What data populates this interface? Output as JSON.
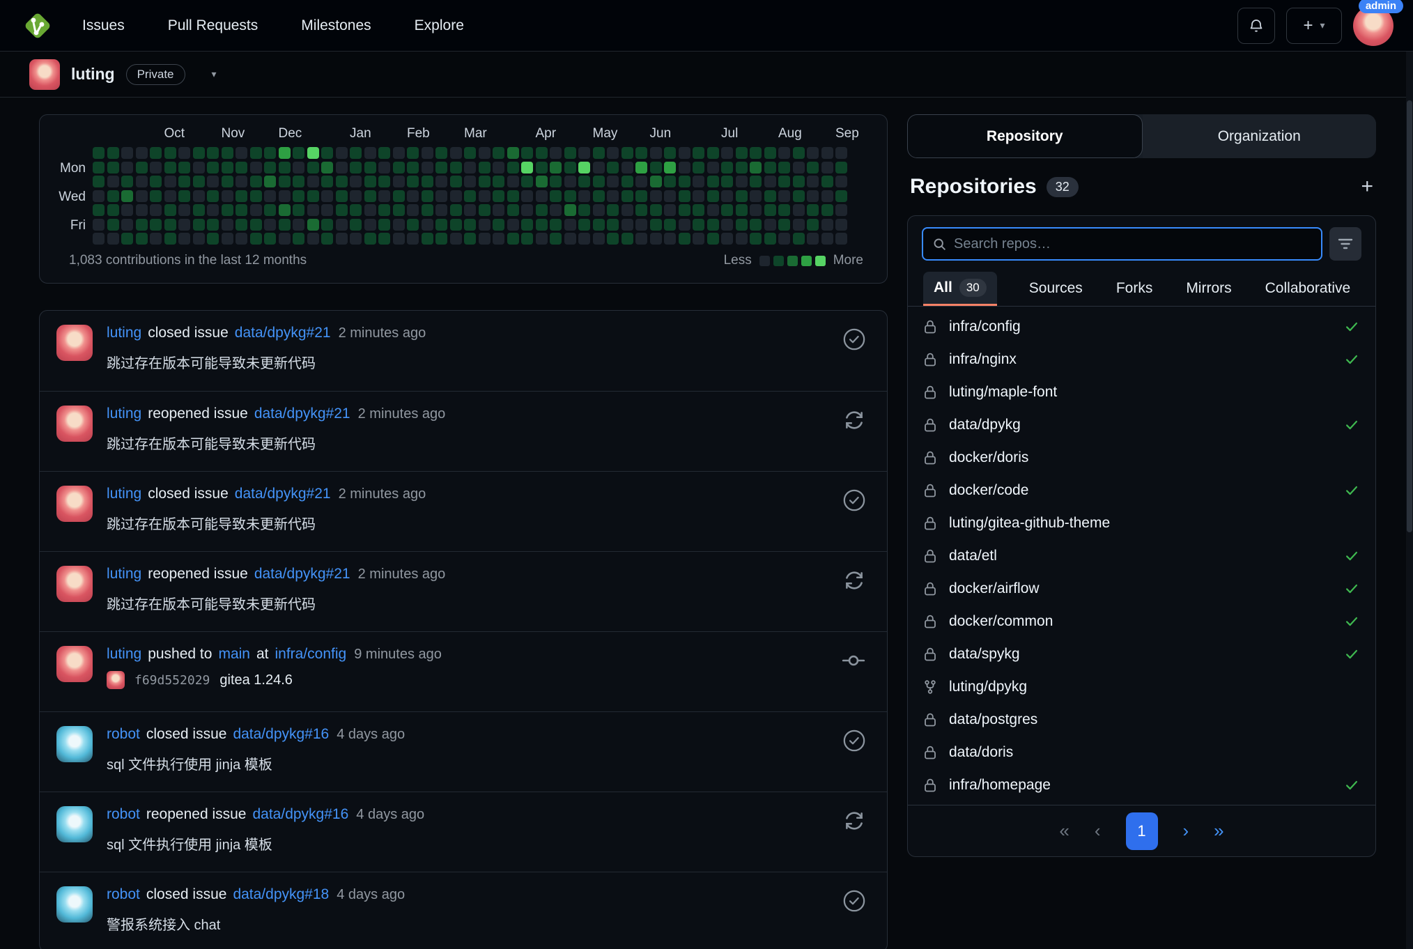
{
  "navbar": {
    "links": [
      "Issues",
      "Pull Requests",
      "Milestones",
      "Explore"
    ],
    "admin_badge": "admin",
    "plus_label": "+",
    "caret": "▾"
  },
  "subheader": {
    "username": "luting",
    "badge": "Private",
    "caret": "▾"
  },
  "heatmap": {
    "total_label": "1,083 contributions in the last 12 months",
    "less_label": "Less",
    "more_label": "More",
    "level_colors": [
      "#1e252e",
      "#0e4429",
      "#1a6b33",
      "#2ea043",
      "#56d364"
    ],
    "months": [
      {
        "label": "Oct",
        "col": 5
      },
      {
        "label": "Nov",
        "col": 9
      },
      {
        "label": "Dec",
        "col": 13
      },
      {
        "label": "Jan",
        "col": 18
      },
      {
        "label": "Feb",
        "col": 22
      },
      {
        "label": "Mar",
        "col": 26
      },
      {
        "label": "Apr",
        "col": 31
      },
      {
        "label": "May",
        "col": 35
      },
      {
        "label": "Jun",
        "col": 39
      },
      {
        "label": "Jul",
        "col": 44
      },
      {
        "label": "Aug",
        "col": 48
      },
      {
        "label": "Sep",
        "col": 52
      }
    ],
    "day_labels": [
      {
        "label": "Mon",
        "row": 1
      },
      {
        "label": "Wed",
        "row": 3
      },
      {
        "label": "Fri",
        "row": 5
      }
    ],
    "weeks": [
      "1110100",
      "1101110",
      "0012001",
      "0100011",
      "1011010",
      "1100111",
      "0111000",
      "1010110",
      "1101011",
      "1110100",
      "0101110",
      "1011011",
      "1120101",
      "3110210",
      "1011101",
      "4101020",
      "1210011",
      "0011100",
      "1100110",
      "0111001",
      "1010111",
      "0101100",
      "1110010",
      "0011101",
      "1100011",
      "0110110",
      "1001011",
      "0110100",
      "1011010",
      "2101101",
      "1410011",
      "1120110",
      "0211011",
      "1101200",
      "0410110",
      "1011010",
      "0100111",
      "1011001",
      "1301100",
      "0120110",
      "1310010",
      "0011101",
      "1100110",
      "1011011",
      "0110100",
      "1101110",
      "1210011",
      "1101101",
      "0110110",
      "1011001",
      "0100110",
      "0010100",
      "0101000"
    ]
  },
  "feed": {
    "items": [
      {
        "avatar": "luting",
        "icon": "check-circle",
        "title": [
          {
            "text": "luting",
            "type": "link"
          },
          {
            "text": "closed issue",
            "type": "text"
          },
          {
            "text": "data/dpykg#21",
            "type": "link"
          },
          {
            "text": "2 minutes ago",
            "type": "time"
          }
        ],
        "body": {
          "type": "text",
          "text": "跳过存在版本可能导致未更新代码"
        }
      },
      {
        "avatar": "luting",
        "icon": "reopen",
        "title": [
          {
            "text": "luting",
            "type": "link"
          },
          {
            "text": "reopened issue",
            "type": "text"
          },
          {
            "text": "data/dpykg#21",
            "type": "link"
          },
          {
            "text": "2 minutes ago",
            "type": "time"
          }
        ],
        "body": {
          "type": "text",
          "text": "跳过存在版本可能导致未更新代码"
        }
      },
      {
        "avatar": "luting",
        "icon": "check-circle",
        "title": [
          {
            "text": "luting",
            "type": "link"
          },
          {
            "text": "closed issue",
            "type": "text"
          },
          {
            "text": "data/dpykg#21",
            "type": "link"
          },
          {
            "text": "2 minutes ago",
            "type": "time"
          }
        ],
        "body": {
          "type": "text",
          "text": "跳过存在版本可能导致未更新代码"
        }
      },
      {
        "avatar": "luting",
        "icon": "reopen",
        "title": [
          {
            "text": "luting",
            "type": "link"
          },
          {
            "text": "reopened issue",
            "type": "text"
          },
          {
            "text": "data/dpykg#21",
            "type": "link"
          },
          {
            "text": "2 minutes ago",
            "type": "time"
          }
        ],
        "body": {
          "type": "text",
          "text": "跳过存在版本可能导致未更新代码"
        }
      },
      {
        "avatar": "luting",
        "icon": "commit",
        "title": [
          {
            "text": "luting",
            "type": "link"
          },
          {
            "text": "pushed to",
            "type": "text"
          },
          {
            "text": "main",
            "type": "link"
          },
          {
            "text": "at",
            "type": "text"
          },
          {
            "text": "infra/config",
            "type": "link"
          },
          {
            "text": "9 minutes ago",
            "type": "time"
          }
        ],
        "body": {
          "type": "commit",
          "hash": "f69d552029",
          "message": "gitea 1.24.6"
        }
      },
      {
        "avatar": "robot",
        "icon": "check-circle",
        "title": [
          {
            "text": "robot",
            "type": "link"
          },
          {
            "text": "closed issue",
            "type": "text"
          },
          {
            "text": "data/dpykg#16",
            "type": "link"
          },
          {
            "text": "4 days ago",
            "type": "time"
          }
        ],
        "body": {
          "type": "text",
          "text": "sql 文件执行使用 jinja 模板"
        }
      },
      {
        "avatar": "robot",
        "icon": "reopen",
        "title": [
          {
            "text": "robot",
            "type": "link"
          },
          {
            "text": "reopened issue",
            "type": "text"
          },
          {
            "text": "data/dpykg#16",
            "type": "link"
          },
          {
            "text": "4 days ago",
            "type": "time"
          }
        ],
        "body": {
          "type": "text",
          "text": "sql 文件执行使用 jinja 模板"
        }
      },
      {
        "avatar": "robot",
        "icon": "check-circle",
        "title": [
          {
            "text": "robot",
            "type": "link"
          },
          {
            "text": "closed issue",
            "type": "text"
          },
          {
            "text": "data/dpykg#18",
            "type": "link"
          },
          {
            "text": "4 days ago",
            "type": "time"
          }
        ],
        "body": {
          "type": "text",
          "text": "警报系统接入 chat"
        }
      }
    ]
  },
  "panel": {
    "tabs": [
      {
        "label": "Repository",
        "active": true
      },
      {
        "label": "Organization",
        "active": false
      }
    ],
    "heading": "Repositories",
    "count": "32",
    "add_label": "+",
    "search_placeholder": "Search repos…",
    "filters": [
      {
        "label": "All",
        "badge": "30",
        "active": true
      },
      {
        "label": "Sources",
        "active": false
      },
      {
        "label": "Forks",
        "active": false
      },
      {
        "label": "Mirrors",
        "active": false
      },
      {
        "label": "Collaborative",
        "active": false
      }
    ],
    "repos": [
      {
        "name": "infra/config",
        "icon": "lock",
        "check": true
      },
      {
        "name": "infra/nginx",
        "icon": "lock",
        "check": true
      },
      {
        "name": "luting/maple-font",
        "icon": "lock",
        "check": false
      },
      {
        "name": "data/dpykg",
        "icon": "lock",
        "check": true
      },
      {
        "name": "docker/doris",
        "icon": "lock",
        "check": false
      },
      {
        "name": "docker/code",
        "icon": "lock",
        "check": true
      },
      {
        "name": "luting/gitea-github-theme",
        "icon": "lock",
        "check": false
      },
      {
        "name": "data/etl",
        "icon": "lock",
        "check": true
      },
      {
        "name": "docker/airflow",
        "icon": "lock",
        "check": true
      },
      {
        "name": "docker/common",
        "icon": "lock",
        "check": true
      },
      {
        "name": "data/spykg",
        "icon": "lock",
        "check": true
      },
      {
        "name": "luting/dpykg",
        "icon": "fork",
        "check": false
      },
      {
        "name": "data/postgres",
        "icon": "lock",
        "check": false
      },
      {
        "name": "data/doris",
        "icon": "lock",
        "check": false
      },
      {
        "name": "infra/homepage",
        "icon": "lock",
        "check": true
      }
    ],
    "pagination": [
      {
        "label": "«",
        "state": "disabled"
      },
      {
        "label": "‹",
        "state": "disabled"
      },
      {
        "label": "1",
        "state": "current"
      },
      {
        "label": "›",
        "state": "enabled"
      },
      {
        "label": "»",
        "state": "enabled"
      }
    ]
  }
}
